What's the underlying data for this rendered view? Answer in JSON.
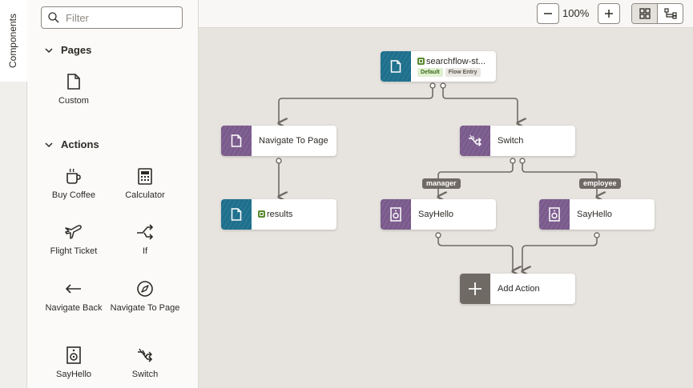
{
  "side_tab": {
    "label": "Components"
  },
  "filter": {
    "placeholder": "Filter"
  },
  "sections": {
    "pages": {
      "title": "Pages",
      "items": [
        {
          "label": "Custom",
          "icon": "page-icon"
        }
      ]
    },
    "actions": {
      "title": "Actions",
      "items": [
        {
          "label": "Buy Coffee",
          "icon": "coffee-cup-icon"
        },
        {
          "label": "Calculator",
          "icon": "calculator-icon"
        },
        {
          "label": "Flight Ticket",
          "icon": "airplane-icon"
        },
        {
          "label": "If",
          "icon": "branch-arrows-icon"
        },
        {
          "label": "Navigate Back",
          "icon": "arrow-left-icon"
        },
        {
          "label": "Navigate To Page",
          "icon": "compass-icon"
        },
        {
          "label": "SayHello",
          "icon": "speaker-icon"
        },
        {
          "label": "Switch",
          "icon": "switch-arrows-icon"
        }
      ]
    }
  },
  "toolbar": {
    "zoom_out": "−",
    "zoom_level": "100%",
    "zoom_in": "+",
    "view_grid_icon": "grid-icon",
    "view_flow_icon": "flow-icon",
    "active_view": "grid"
  },
  "flow": {
    "start": {
      "label": "searchflow-st...",
      "badges": [
        "Default",
        "Flow Entry"
      ]
    },
    "navigate": {
      "label": "Navigate To Page"
    },
    "switch": {
      "label": "Switch"
    },
    "results": {
      "label": "results"
    },
    "sayhello_manager": {
      "label": "SayHello"
    },
    "sayhello_employee": {
      "label": "SayHello"
    },
    "add_action": {
      "label": "Add Action"
    },
    "edge_labels": {
      "manager": "manager",
      "employee": "employee"
    }
  },
  "colors": {
    "teal": "#1d6f8c",
    "purple": "#7a5a8c",
    "gray_action": "#6f6a64",
    "canvas": "#e7e4df",
    "connector": "#6f6a64"
  }
}
